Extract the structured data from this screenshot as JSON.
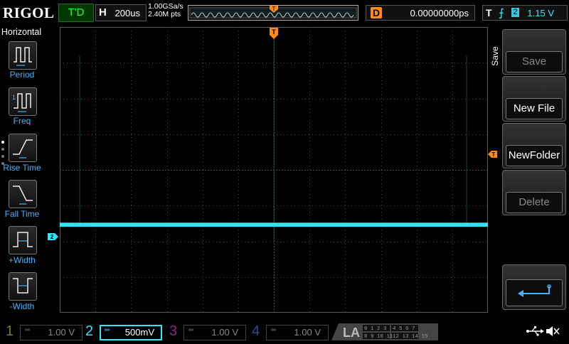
{
  "header": {
    "brand": "RIGOL",
    "trigger_status": "T'D",
    "horizontal": {
      "label": "H",
      "timebase": "200us"
    },
    "sample_rate": "1.00GSa/s",
    "memory_depth": "2.40M pts",
    "delay": {
      "label": "D",
      "value": "0.00000000ps"
    },
    "trigger": {
      "label": "T",
      "edge_symbol": "⨍",
      "source": "2",
      "level": "1.15 V"
    }
  },
  "left_menu": {
    "title": "Horizontal",
    "items": [
      {
        "label": "Period",
        "icon": "period-icon"
      },
      {
        "label": "Freq",
        "icon": "frequency-icon"
      },
      {
        "label": "Rise Time",
        "icon": "rise-time-icon"
      },
      {
        "label": "Fall Time",
        "icon": "fall-time-icon"
      },
      {
        "label": "+Width",
        "icon": "positive-width-icon"
      },
      {
        "label": "-Width",
        "icon": "negative-width-icon"
      }
    ]
  },
  "right_menu": {
    "title": "Save",
    "items": [
      {
        "label": "Save",
        "enabled": false
      },
      {
        "label": "New File",
        "enabled": true
      },
      {
        "label": "NewFolder",
        "enabled": true
      },
      {
        "label": "Delete",
        "enabled": false
      }
    ],
    "return_icon": "return-arrow-icon"
  },
  "markers": {
    "trigger_position": "T",
    "channel2_ground": "2"
  },
  "channels": [
    {
      "number": "1",
      "scale": "1.00 V",
      "color": "#7a7a2a",
      "active": false
    },
    {
      "number": "2",
      "scale": "500mV",
      "color": "#2ce6ff",
      "active": true
    },
    {
      "number": "3",
      "scale": "1.00 V",
      "color": "#8a2a8a",
      "active": false
    },
    {
      "number": "4",
      "scale": "1.00 V",
      "color": "#2a4a9a",
      "active": false
    }
  ],
  "logic_analyzer": {
    "label": "LA",
    "rows": [
      "0 1 2 3",
      "4 5 6 7",
      "8 9 10 11",
      "12 13 14 15"
    ]
  },
  "status_icons": [
    "usb-icon",
    "speaker-muted-icon"
  ],
  "colors": {
    "trace": "#2ce6ff",
    "trigger_marker": "#ff8c1a",
    "menu_label": "#3fb5ff",
    "grid": "#4a4a4a"
  }
}
